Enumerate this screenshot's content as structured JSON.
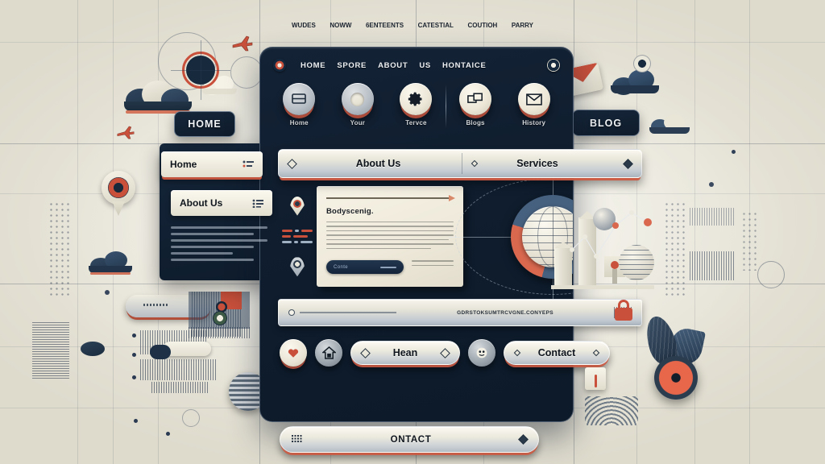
{
  "page": {
    "title": "Website Layout Concept Mockup",
    "background_color": "#e8e5da",
    "accent_color": "#c9513c",
    "panel_color": "#0f1d2e"
  },
  "top_banner": {
    "items": [
      "WUDES",
      "NOWW",
      "6ENTEENTS",
      "CATESTIAL",
      "COUTIOH",
      "PARRY"
    ]
  },
  "window": {
    "topnav": {
      "brand_left_icon": "target-icon",
      "brand_right_icon": "circle-icon",
      "links": [
        "HOME",
        "SPORE",
        "ABOUT",
        "US",
        "HONTAICE"
      ]
    },
    "icon_row": [
      {
        "label": "Home",
        "icon": "menu-bars-icon",
        "style": "grey"
      },
      {
        "label": "Your",
        "icon": "circle-dot-icon",
        "style": "grey"
      },
      {
        "label": "Tervce",
        "icon": "gear-icon",
        "style": "cream"
      },
      {
        "label": "Blogs",
        "icon": "windows-icon",
        "style": "cream"
      },
      {
        "label": "History",
        "icon": "envelope-icon",
        "style": "cream"
      }
    ],
    "tabs": [
      {
        "label": "About Us",
        "icon": "diamond-icon",
        "active": true
      },
      {
        "label": "Services",
        "icon": "diamond-small-icon",
        "active": false
      }
    ],
    "tab_end_icon": "diamond-icon",
    "content_card": {
      "heading": "Bodyscenig.",
      "button_label": "Conte",
      "body_line_count": 7
    },
    "globe": {
      "icon": "globe-icon",
      "ring_accent": "#d9684f",
      "ring_base": "#46617f"
    },
    "long_bar": {
      "text": "GDRSTOKSUMTRCVGNE.CONYEPS",
      "knob_icon": "slider-knob-icon"
    },
    "action_row": [
      {
        "type": "icon",
        "name": "heart-icon",
        "style": "cream"
      },
      {
        "type": "icon",
        "name": "home-icon",
        "style": "grey"
      },
      {
        "type": "pill",
        "label": "Hean",
        "left_icon": "diamond-icon",
        "right_icon": "diamond-icon"
      },
      {
        "type": "icon",
        "name": "face-icon",
        "style": "grey"
      },
      {
        "type": "pill",
        "label": "Contact",
        "left_icon": "diamond-small-icon",
        "right_icon": "diamond-small-icon"
      }
    ],
    "bottom_button": {
      "label": "ONTACT",
      "left_icon": "grid-icon",
      "right_icon": "diamond-icon"
    }
  },
  "edge_tabs": [
    {
      "id": "home",
      "label": "HOME"
    },
    {
      "id": "blog",
      "label": "BLOG"
    }
  ],
  "side_panel": {
    "items": [
      {
        "label": "Home",
        "icon": "list-icon"
      },
      {
        "label": "About Us",
        "icon": "list-icon"
      }
    ]
  },
  "decorations": {
    "clouds": 3,
    "plane_icons": 2,
    "pin_icons": 3,
    "lock_icon": "lock-icon",
    "warning_icon": "warning-icon",
    "leaf_icons": 2,
    "chart_icon": "line-chart-icon",
    "sphere_icons": 3
  }
}
